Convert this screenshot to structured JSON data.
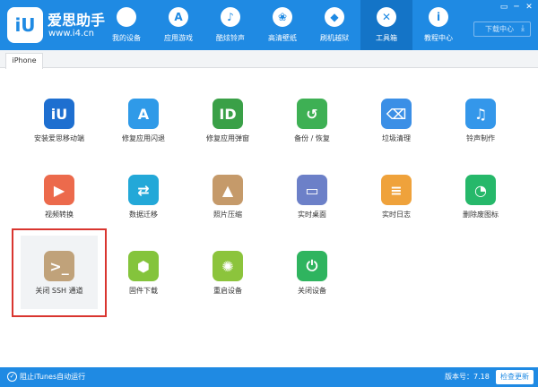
{
  "header": {
    "logo_text": "iU",
    "brand": "爱思助手",
    "url": "www.i4.cn",
    "nav": [
      {
        "label": "我的设备",
        "icon": "apple-icon",
        "glyph": ""
      },
      {
        "label": "应用游戏",
        "icon": "app-store-icon",
        "glyph": "A"
      },
      {
        "label": "酷炫铃声",
        "icon": "bell-icon",
        "glyph": "♪"
      },
      {
        "label": "高清壁纸",
        "icon": "flower-icon",
        "glyph": "❀"
      },
      {
        "label": "刷机越狱",
        "icon": "dropbox-icon",
        "glyph": "◆"
      },
      {
        "label": "工具箱",
        "icon": "tools-icon",
        "glyph": "✕"
      },
      {
        "label": "教程中心",
        "icon": "info-icon",
        "glyph": "i"
      }
    ],
    "active_nav": 5,
    "window_buttons": [
      "▭",
      "─",
      "✕"
    ],
    "download_label": "下载中心"
  },
  "tabs": [
    {
      "label": "iPhone"
    }
  ],
  "tools": [
    {
      "label": "安装爱思移动端",
      "icon": "i4-mobile-icon",
      "glyph": "iU",
      "color": "#1e6fd0"
    },
    {
      "label": "修复应用闪退",
      "icon": "app-store-repair-icon",
      "glyph": "A",
      "color": "#2f9ae8"
    },
    {
      "label": "修复应用弹窗",
      "icon": "apple-id-icon",
      "glyph": "ID",
      "color": "#3aa047"
    },
    {
      "label": "备份 / 恢复",
      "icon": "backup-restore-icon",
      "glyph": "↺",
      "color": "#3eb054"
    },
    {
      "label": "垃圾清理",
      "icon": "broom-icon",
      "glyph": "⌫",
      "color": "#3b8fe6"
    },
    {
      "label": "铃声制作",
      "icon": "bell-icon",
      "glyph": "♫",
      "color": "#3497ea"
    },
    {
      "label": "视频转换",
      "icon": "video-convert-icon",
      "glyph": "▶",
      "color": "#ec6a4c"
    },
    {
      "label": "数据迁移",
      "icon": "data-migration-icon",
      "glyph": "⇄",
      "color": "#23a8d8"
    },
    {
      "label": "照片压缩",
      "icon": "photo-compress-icon",
      "glyph": "▲",
      "color": "#c59a6a"
    },
    {
      "label": "实时桌面",
      "icon": "realtime-desktop-icon",
      "glyph": "▭",
      "color": "#6c80c8"
    },
    {
      "label": "实时日志",
      "icon": "realtime-log-icon",
      "glyph": "≡",
      "color": "#efa23b"
    },
    {
      "label": "删除废图标",
      "icon": "delete-icon-icon",
      "glyph": "◔",
      "color": "#26b86a"
    },
    {
      "label": "关闭 SSH 通道",
      "icon": "terminal-icon",
      "glyph": ">_",
      "color": "#c0a27a"
    },
    {
      "label": "固件下载",
      "icon": "firmware-download-icon",
      "glyph": "⬢",
      "color": "#84c43c"
    },
    {
      "label": "重启设备",
      "icon": "restart-icon",
      "glyph": "✺",
      "color": "#8cc43c"
    },
    {
      "label": "关闭设备",
      "icon": "power-icon",
      "glyph": "⏻",
      "color": "#2fb45f"
    }
  ],
  "footer": {
    "itunes_label": "阻止iTunes自动运行",
    "version": "版本号：7.18",
    "update_label": "检查更新"
  }
}
